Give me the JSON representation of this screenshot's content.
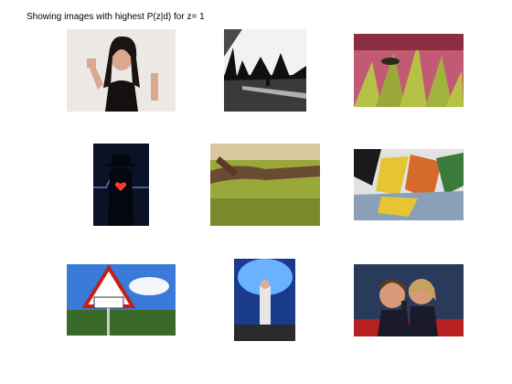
{
  "figure": {
    "title": "Showing images with highest P(z|d) for z= 1"
  },
  "images": [
    {
      "subject": "woman with dark hair making rock hand gesture on white background",
      "palette": [
        "#ece8e4",
        "#1b1410",
        "#d8a890"
      ]
    },
    {
      "subject": "black and white city street with silhouetted figure",
      "palette": [
        "#f2f2f2",
        "#7a7a7a",
        "#101010"
      ]
    },
    {
      "subject": "close-up of pink and green leaves with caterpillar",
      "palette": [
        "#c25a74",
        "#b6c246",
        "#8a2e40"
      ]
    },
    {
      "subject": "silhouette with hat and glowing red heart in dark",
      "palette": [
        "#0c1226",
        "#5a7ab8",
        "#ff3a30"
      ]
    },
    {
      "subject": "fallen tree trunk on grassy meadow",
      "palette": [
        "#6a4a32",
        "#9aa83a",
        "#d8c8a0"
      ]
    },
    {
      "subject": "colorful graffiti on wall",
      "palette": [
        "#e6c432",
        "#e2e2e2",
        "#1a1a1a"
      ]
    },
    {
      "subject": "triangular children crossing road sign under blue sky",
      "palette": [
        "#3a7ad8",
        "#c0201a",
        "#3a6a2a"
      ]
    },
    {
      "subject": "performer on stage under blue spotlight",
      "palette": [
        "#1a3a8a",
        "#6ab2ff",
        "#e6e6e6"
      ]
    },
    {
      "subject": "two women singing into microphone",
      "palette": [
        "#2a3a5a",
        "#d89a7a",
        "#b62020"
      ]
    }
  ]
}
